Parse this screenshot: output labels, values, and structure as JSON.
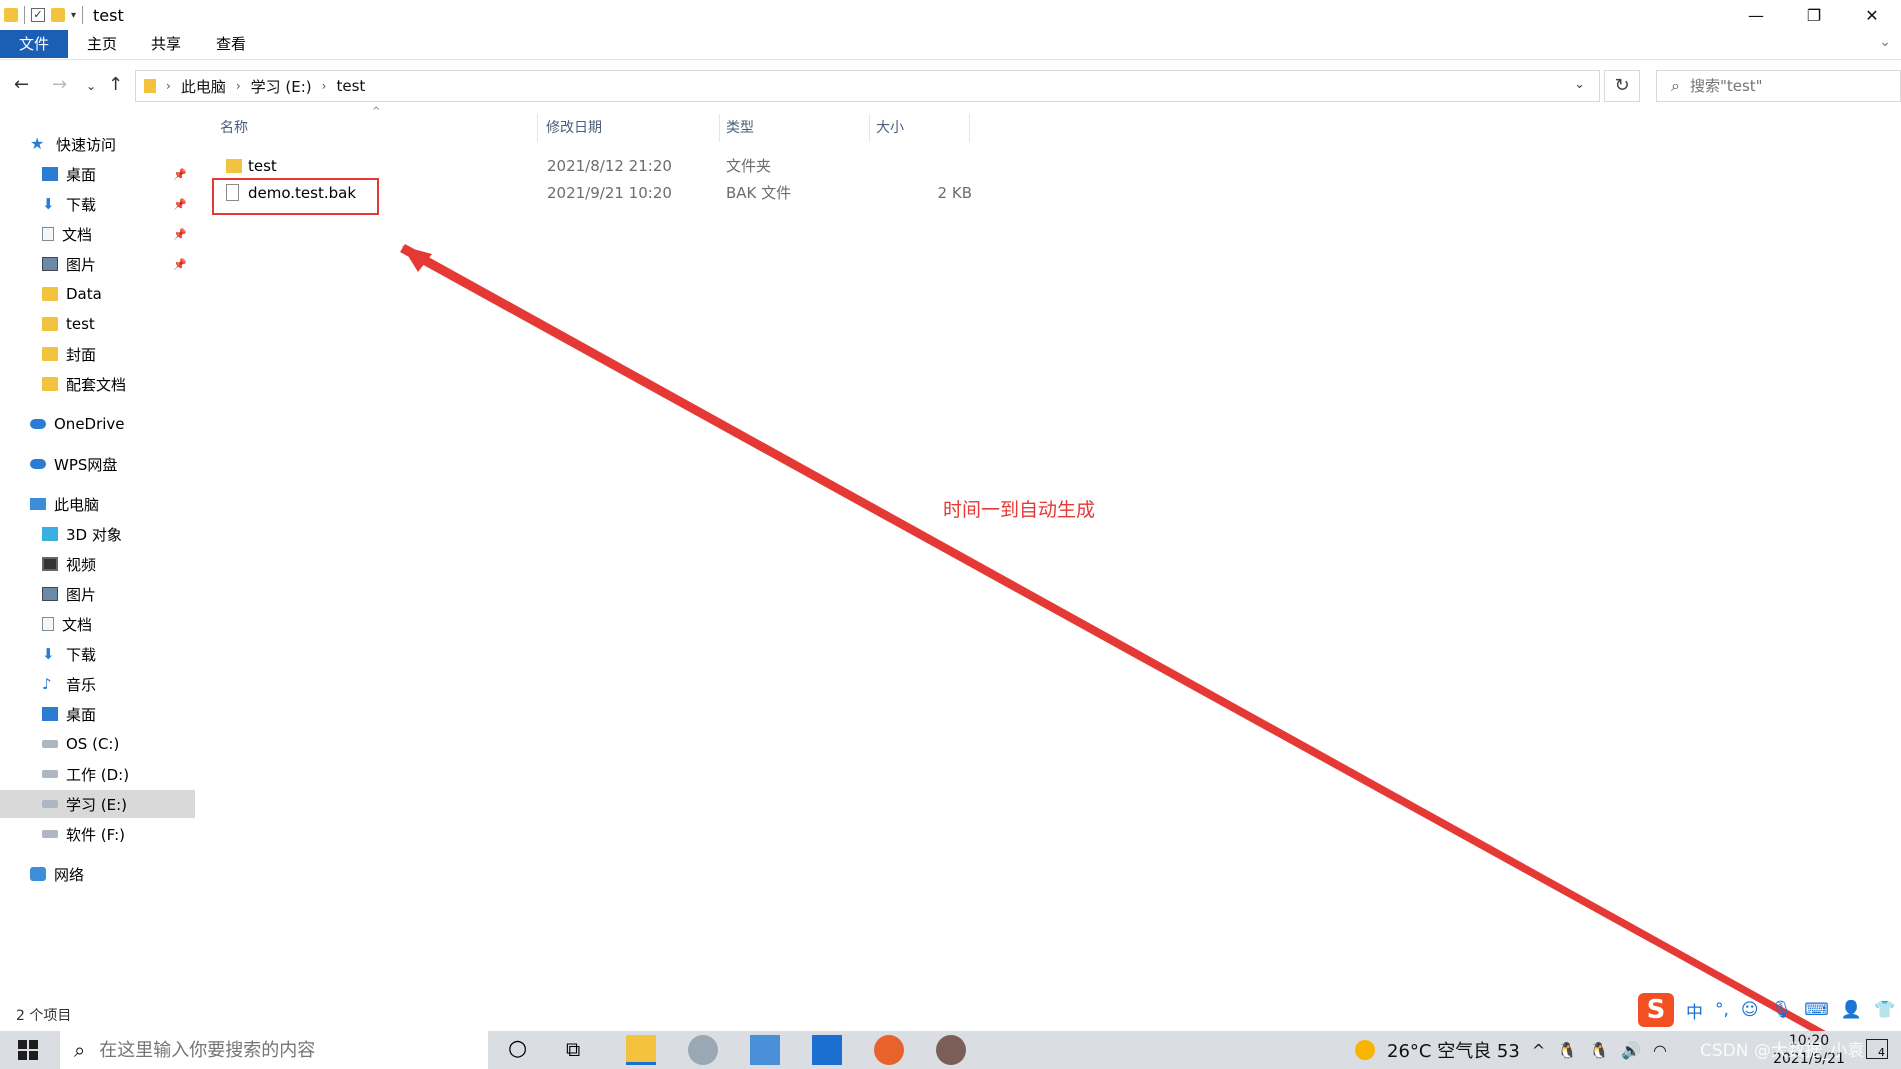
{
  "window": {
    "title": "test",
    "minimize_glyph": "—",
    "restore_glyph": "❐",
    "close_glyph": "✕"
  },
  "ribbon": {
    "tabs": [
      "文件",
      "主页",
      "共享",
      "查看"
    ]
  },
  "address": {
    "crumbs": [
      "此电脑",
      "学习 (E:)",
      "test"
    ],
    "search_placeholder": "搜索\"test\""
  },
  "sidebar": {
    "quick_access": "快速访问",
    "pinned": [
      "桌面",
      "下载",
      "文档",
      "图片"
    ],
    "recent": [
      "Data",
      "test",
      "封面",
      "配套文档"
    ],
    "onedrive": "OneDrive",
    "wps": "WPS网盘",
    "this_pc": "此电脑",
    "pc_items": [
      "3D 对象",
      "视频",
      "图片",
      "文档",
      "下载",
      "音乐",
      "桌面",
      "OS (C:)",
      "工作 (D:)",
      "学习 (E:)",
      "软件 (F:)"
    ],
    "network": "网络"
  },
  "columns": [
    "名称",
    "修改日期",
    "类型",
    "大小"
  ],
  "files": [
    {
      "name": "test",
      "modified": "2021/8/12 21:20",
      "type": "文件夹",
      "size": ""
    },
    {
      "name": "demo.test.bak",
      "modified": "2021/9/21 10:20",
      "type": "BAK 文件",
      "size": "2 KB"
    }
  ],
  "annotation": {
    "text": "时间一到自动生成",
    "color": "#e53935"
  },
  "status": {
    "item_count": "2 个项目"
  },
  "ime": {
    "logo": "S",
    "lang": "中"
  },
  "taskbar": {
    "search_placeholder": "在这里输入你要搜索的内容",
    "weather": "26°C 空气良 53",
    "time": "10:20",
    "date": "2021/9/21",
    "notifications": "4",
    "watermark": "CSDN @大数据_小袁"
  }
}
